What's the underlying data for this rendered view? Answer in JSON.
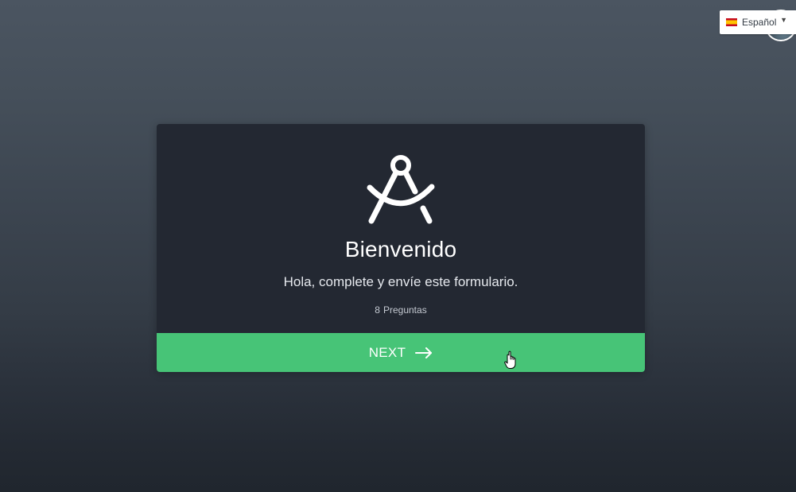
{
  "language_selector": {
    "flag_icon": "spain-flag-icon",
    "label": "Español",
    "caret": "▼"
  },
  "avatar": {
    "icon": "user-avatar"
  },
  "welcome_card": {
    "logo_icon": "compass-icon",
    "title": "Bienvenido",
    "subtitle": "Hola, complete y envíe este formulario.",
    "question_count": "8",
    "question_label": "Preguntas",
    "next_button": {
      "label": "NEXT",
      "icon": "arrow-right-icon",
      "color": "#47c477"
    }
  },
  "colors": {
    "card_background": "#232832",
    "accent": "#47c477"
  }
}
